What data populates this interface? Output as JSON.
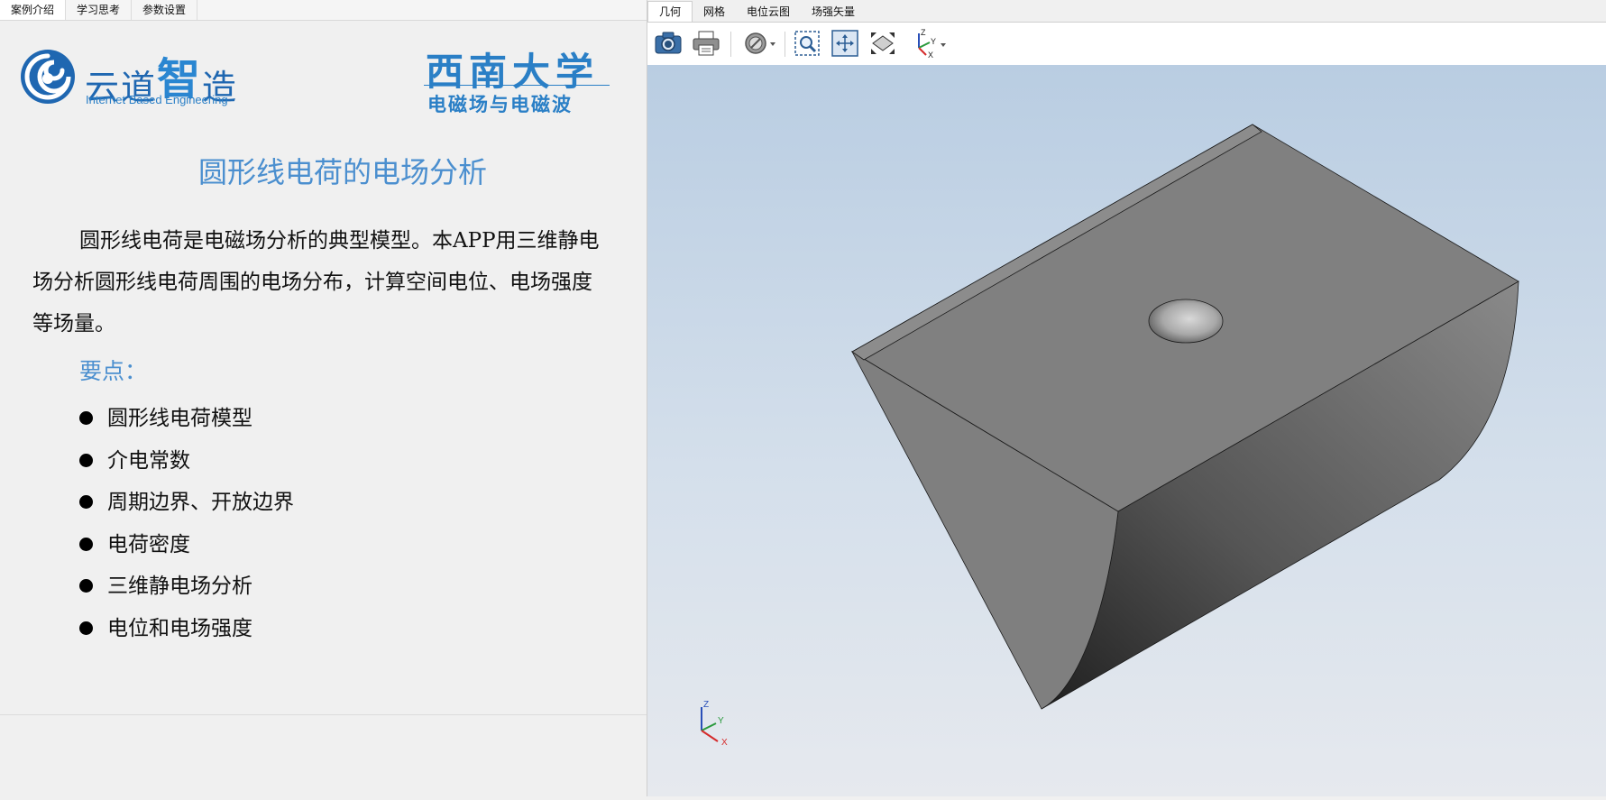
{
  "left_panel": {
    "tabs": [
      {
        "label": "案例介绍"
      },
      {
        "label": "学习思考"
      },
      {
        "label": "参数设置"
      }
    ],
    "logo": {
      "name_part1": "云道",
      "name_part2": "智",
      "name_part3": "造",
      "subtitle": "Internet Based Engineering"
    },
    "university": {
      "name": "西南大学",
      "course": "电磁场与电磁波"
    },
    "title": "圆形线电荷的电场分析",
    "intro": "圆形线电荷是电磁场分析的典型模型。本APP用三维静电场分析圆形线电荷周围的电场分布，计算空间电位、电场强度等场量。",
    "key_points_title": "要点：",
    "key_points": [
      {
        "text": "圆形线电荷模型"
      },
      {
        "text": "介电常数"
      },
      {
        "text": "周期边界、开放边界"
      },
      {
        "text": "电荷密度"
      },
      {
        "text": "三维静电场分析"
      },
      {
        "text": "电位和电场强度"
      }
    ]
  },
  "right_panel": {
    "tabs": [
      {
        "label": "几何"
      },
      {
        "label": "网格"
      },
      {
        "label": "电位云图"
      },
      {
        "label": "场强矢量"
      }
    ],
    "toolbar": [
      {
        "icon": "camera-icon"
      },
      {
        "icon": "print-icon"
      },
      {
        "icon": "no-entry-icon"
      },
      {
        "icon": "zoom-box-icon"
      },
      {
        "icon": "pan-icon"
      },
      {
        "icon": "fit-view-icon"
      },
      {
        "icon": "axis-orientation-icon"
      }
    ],
    "triad": {
      "x": "X",
      "y": "Y",
      "z": "Z"
    },
    "colors": {
      "model_face": "#808080",
      "viewport_top": "#b9cde2",
      "viewport_bottom": "#e6e9ee",
      "accent_blue": "#4b8fcf"
    }
  }
}
